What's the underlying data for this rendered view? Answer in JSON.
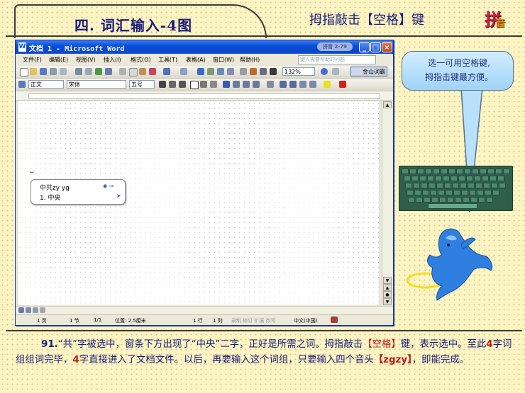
{
  "slide": {
    "title": "四. 词汇输入-4图",
    "subtitle": "拇指敲击【空格】键",
    "logo_big": "拼",
    "logo_small": "音"
  },
  "word": {
    "window_title": "文档 1 - Microsoft Word",
    "doc_icon": "W",
    "help_badge": "拼音 2-79",
    "btn_min": "_",
    "btn_max": "□",
    "btn_close": "×",
    "menu": [
      "文件(F)",
      "编辑(E)",
      "视图(V)",
      "插入(I)",
      "格式(O)",
      "工具(T)",
      "表格(A)",
      "窗口(W)",
      "帮助(H)"
    ],
    "ask_placeholder": "键入需要帮助的问题",
    "zoom": "132%",
    "jinshan": "金山词霸",
    "style": "正文",
    "font": "宋体",
    "size": "五号",
    "ime": {
      "composition": "中共zy yg",
      "candidate": "1. 中央",
      "nav": "◆ ⇒",
      "arrow": "➤"
    },
    "status": {
      "page": "1 页",
      "section": "1 节",
      "pages": "1/1",
      "position": "位置: 2.5厘米",
      "line": "1 行",
      "col": "1 列",
      "modes": "录制  修订  扩展  改写",
      "lang": "中文(中国)"
    }
  },
  "tooltip": {
    "line1": "选一可用空格键,",
    "line2": "拇指击键最方便。"
  },
  "caption": {
    "num": "91.",
    "t1": "“共”字被选中，窗条下方出现了“中央”二字，正好是所需之词。拇指敲击",
    "k1": "【空格】",
    "t2": "键，表示选中。至此",
    "n1": "4",
    "t3": "字词组组词完毕，",
    "n2": "4",
    "t4": "字直接进入了文档文件。以后，再要输入这个词组，只要输入四个音头",
    "k2": "【zgzy】",
    "t5": "，即能完成。"
  },
  "colors": {
    "background": "#fdf4c4",
    "title_text": "#1a1a7a",
    "highlight_red": "#c41818",
    "xp_blue": "#0a4fd8",
    "keyboard_green": "#2f5e4c",
    "dolphin_blue": "#2f7fe0"
  }
}
